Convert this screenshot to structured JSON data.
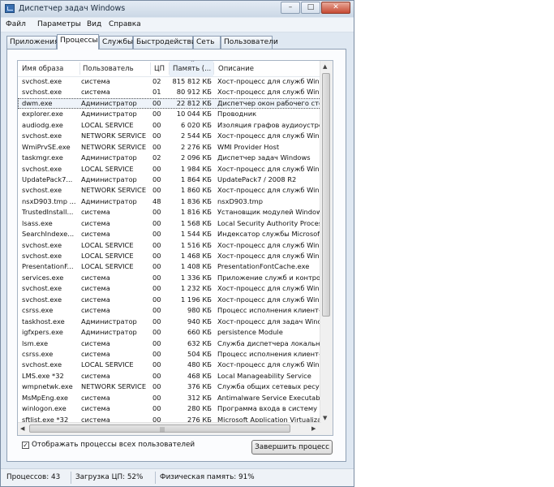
{
  "window": {
    "title": "Диспетчер задач Windows",
    "buttons": {
      "minimize": "–",
      "maximize": "□",
      "close": "✕"
    }
  },
  "menu": [
    "Файл",
    "Параметры",
    "Вид",
    "Справка"
  ],
  "tabs": [
    "Приложения",
    "Процессы",
    "Службы",
    "Быстродействие",
    "Сеть",
    "Пользователи"
  ],
  "active_tab": "Процессы",
  "columns": {
    "name": "Имя образа",
    "user": "Пользователь",
    "cpu": "ЦП",
    "memory": "Память (...",
    "description": "Описание"
  },
  "sort_indicator": "^",
  "processes": [
    [
      "svchost.exe",
      "система",
      "02",
      "815 812 КБ",
      "Хост-процесс для служб Windows"
    ],
    [
      "svchost.exe",
      "система",
      "01",
      "80 912 КБ",
      "Хост-процесс для служб Windows"
    ],
    [
      "dwm.exe",
      "Администратор",
      "00",
      "22 812 КБ",
      "Диспетчер окон рабочего стола"
    ],
    [
      "explorer.exe",
      "Администратор",
      "00",
      "10 044 КБ",
      "Проводник"
    ],
    [
      "audiodg.exe",
      "LOCAL SERVICE",
      "00",
      "6 020 КБ",
      "Изоляция графов аудиоустройств"
    ],
    [
      "svchost.exe",
      "NETWORK SERVICE",
      "00",
      "2 544 КБ",
      "Хост-процесс для служб Windows"
    ],
    [
      "WmiPrvSE.exe",
      "NETWORK SERVICE",
      "00",
      "2 276 КБ",
      "WMI Provider Host"
    ],
    [
      "taskmgr.exe",
      "Администратор",
      "02",
      "2 096 КБ",
      "Диспетчер задач Windows"
    ],
    [
      "svchost.exe",
      "LOCAL SERVICE",
      "00",
      "1 984 КБ",
      "Хост-процесс для служб Windows"
    ],
    [
      "UpdatePack7...",
      "Администратор",
      "00",
      "1 864 КБ",
      "UpdatePack7 / 2008 R2"
    ],
    [
      "svchost.exe",
      "NETWORK SERVICE",
      "00",
      "1 860 КБ",
      "Хост-процесс для служб Windows"
    ],
    [
      "nsxD903.tmp ...",
      "Администратор",
      "48",
      "1 836 КБ",
      "nsxD903.tmp"
    ],
    [
      "TrustedInstall...",
      "система",
      "00",
      "1 816 КБ",
      "Установщик модулей Windows"
    ],
    [
      "lsass.exe",
      "система",
      "00",
      "1 568 КБ",
      "Local Security Authority Process"
    ],
    [
      "SearchIndexe...",
      "система",
      "00",
      "1 544 КБ",
      "Индексатор службы Microsoft Windows"
    ],
    [
      "svchost.exe",
      "LOCAL SERVICE",
      "00",
      "1 516 КБ",
      "Хост-процесс для служб Windows"
    ],
    [
      "svchost.exe",
      "LOCAL SERVICE",
      "00",
      "1 468 КБ",
      "Хост-процесс для служб Windows"
    ],
    [
      "PresentationF...",
      "LOCAL SERVICE",
      "00",
      "1 408 КБ",
      "PresentationFontCache.exe"
    ],
    [
      "services.exe",
      "система",
      "00",
      "1 336 КБ",
      "Приложение служб и контроллеров"
    ],
    [
      "svchost.exe",
      "система",
      "00",
      "1 232 КБ",
      "Хост-процесс для служб Windows"
    ],
    [
      "svchost.exe",
      "система",
      "00",
      "1 196 КБ",
      "Хост-процесс для служб Windows"
    ],
    [
      "csrss.exe",
      "система",
      "00",
      "980 КБ",
      "Процесс исполнения клиент-сервер"
    ],
    [
      "taskhost.exe",
      "Администратор",
      "00",
      "940 КБ",
      "Хост-процесс для задач Windows"
    ],
    [
      "igfxpers.exe",
      "Администратор",
      "00",
      "660 КБ",
      "persistence Module"
    ],
    [
      "lsm.exe",
      "система",
      "00",
      "632 КБ",
      "Служба диспетчера локальных сеансов"
    ],
    [
      "csrss.exe",
      "система",
      "00",
      "504 КБ",
      "Процесс исполнения клиент-сервер"
    ],
    [
      "svchost.exe",
      "LOCAL SERVICE",
      "00",
      "480 КБ",
      "Хост-процесс для служб Windows"
    ],
    [
      "LMS.exe *32",
      "система",
      "00",
      "468 КБ",
      "Local Manageability Service"
    ],
    [
      "wmpnetwk.exe",
      "NETWORK SERVICE",
      "00",
      "376 КБ",
      "Служба общих сетевых ресурсов"
    ],
    [
      "MsMpEng.exe",
      "система",
      "00",
      "312 КБ",
      "Antimalware Service Executable"
    ],
    [
      "winlogon.exe",
      "система",
      "00",
      "280 КБ",
      "Программа входа в систему Windows"
    ],
    [
      "sftlist.exe *32",
      "система",
      "00",
      "276 КБ",
      "Microsoft Application Virtualization"
    ]
  ],
  "selected_row": 2,
  "show_all_label": "Отображать процессы всех пользователей",
  "show_all_checked": true,
  "end_process_label": "Завершить процесс",
  "status": {
    "processes": "Процессов: 43",
    "cpu": "Загрузка ЦП: 52%",
    "memory": "Физическая память: 91%"
  },
  "colors": {
    "title_bg": "#cbd8e6",
    "panel_bg": "#fbfcfe",
    "close_btn": "#c74a33"
  }
}
